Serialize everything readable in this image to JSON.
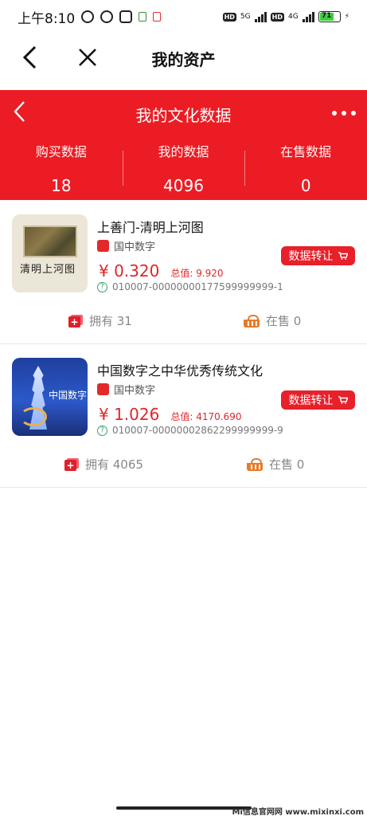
{
  "status": {
    "time": "上午8:10",
    "net1": "5G",
    "net2": "4G",
    "battery": "71"
  },
  "nav": {
    "title": "我的资产"
  },
  "banner": {
    "title": "我的文化数据"
  },
  "stats": [
    {
      "label": "购买数据",
      "value": "18"
    },
    {
      "label": "我的数据",
      "value": "4096"
    },
    {
      "label": "在售数据",
      "value": "0"
    }
  ],
  "items": [
    {
      "name": "上善门-清明上河图",
      "issuer": "国中数字",
      "price": "¥ 0.320",
      "total": "总值: 9.920",
      "code": "010007-00000000177599999999-1",
      "transfer_label": "数据转让",
      "own_label": "拥有 31",
      "sale_label": "在售 0",
      "thumb_text": "清明上河图"
    },
    {
      "name": "中国数字之中华优秀传统文化",
      "issuer": "国中数字",
      "price": "¥ 1.026",
      "total": "总值: 4170.690",
      "code": "010007-00000002862299999999-9",
      "transfer_label": "数据转让",
      "own_label": "拥有 4065",
      "sale_label": "在售 0",
      "thumb_text": "中国数字"
    }
  ],
  "watermark": "Mi信息官网网 www.mixinxi.com",
  "colors": {
    "brand_red": "#ec1c24",
    "price_red": "#e0262a",
    "basket_orange": "#e87a2a"
  }
}
